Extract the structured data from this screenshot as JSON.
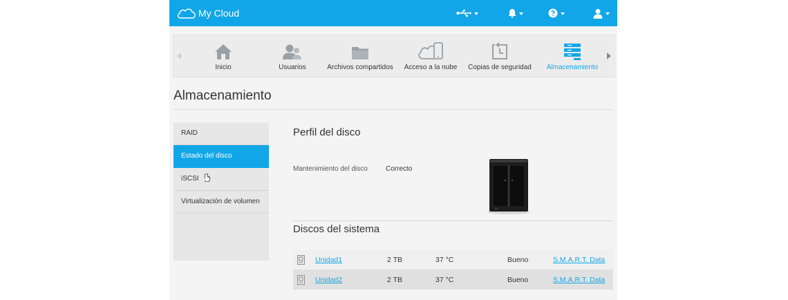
{
  "colors": {
    "accent": "#11a6e8",
    "nav_icon": "#9aa1a6"
  },
  "app": {
    "title": "My Cloud"
  },
  "topbar": {
    "icons": [
      "usb-icon",
      "bell-icon",
      "help-icon",
      "user-icon"
    ]
  },
  "nav": {
    "items": [
      {
        "label": "Inicio",
        "icon": "home-icon"
      },
      {
        "label": "Usuarios",
        "icon": "users-icon"
      },
      {
        "label": "Archivos compartidos",
        "icon": "folder-icon"
      },
      {
        "label": "Acceso a la nube",
        "icon": "cloud-mobile-icon"
      },
      {
        "label": "Copias de seguridad",
        "icon": "backup-icon"
      },
      {
        "label": "Almacenamiento",
        "icon": "storage-icon",
        "active": true
      }
    ]
  },
  "page": {
    "title": "Almacenamiento"
  },
  "sidebar": {
    "items": [
      {
        "label": "RAID"
      },
      {
        "label": "Estado del disco",
        "active": true
      },
      {
        "label": "iSCSI"
      },
      {
        "label": "Virtualización de volumen"
      }
    ]
  },
  "profile": {
    "title": "Perfil del disco",
    "maintenance_label": "Mantenimiento del disco",
    "maintenance_value": "Correcto"
  },
  "disks": {
    "title": "Discos del sistema",
    "rows": [
      {
        "name": "Unidad1",
        "size": "2 TB",
        "temp": "37 °C",
        "status": "Bueno",
        "smart": "S.M.A.R.T. Data"
      },
      {
        "name": "Unidad2",
        "size": "2 TB",
        "temp": "37 °C",
        "status": "Bueno",
        "smart": "S.M.A.R.T. Data"
      }
    ]
  }
}
